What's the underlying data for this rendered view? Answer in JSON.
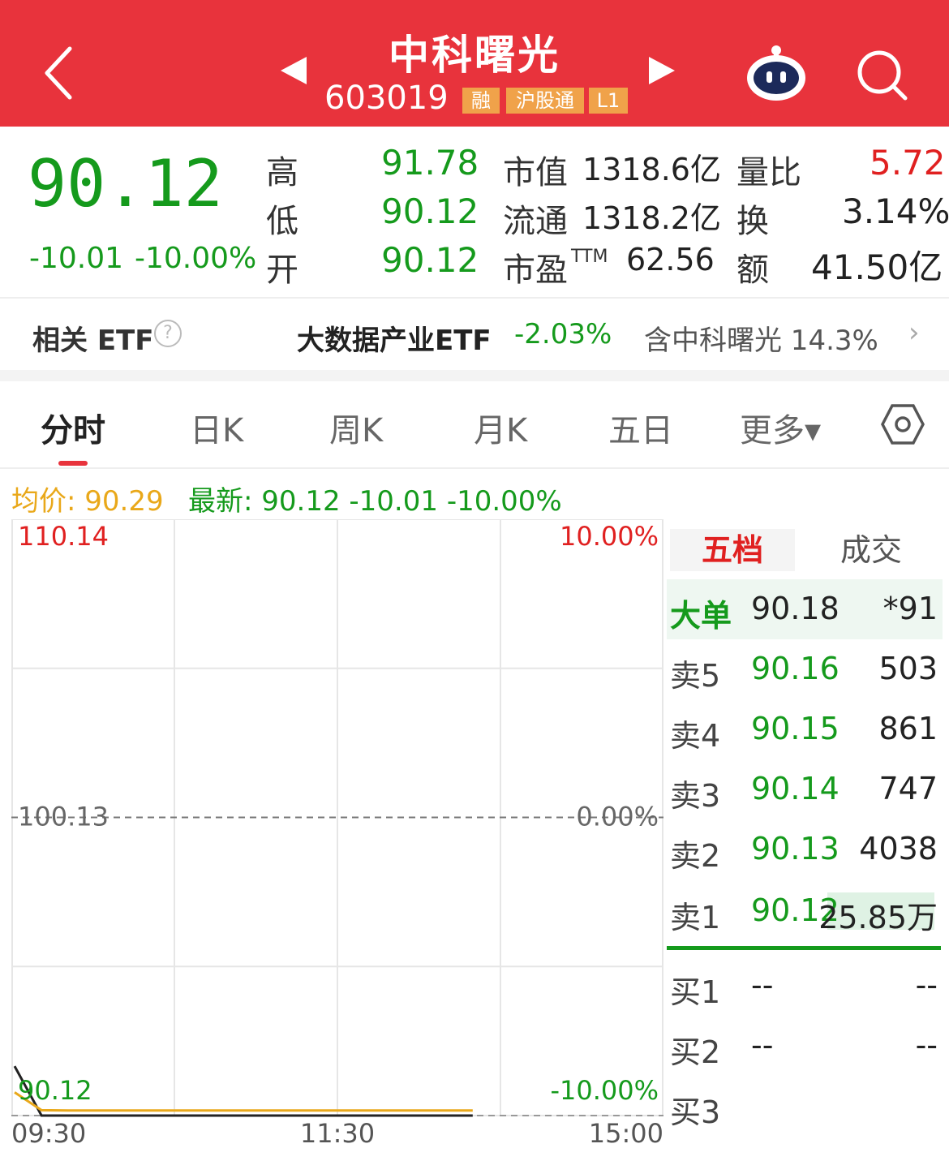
{
  "header": {
    "stock_name": "中科曙光",
    "stock_code": "603019",
    "tags": [
      "融",
      "沪股通",
      "L1"
    ]
  },
  "quote": {
    "price": "90.12",
    "change": "-10.01",
    "change_pct": "-10.00%",
    "high_label": "高",
    "high": "91.78",
    "low_label": "低",
    "low": "90.12",
    "open_label": "开",
    "open": "90.12",
    "mktcap_label": "市值",
    "mktcap": "1318.6亿",
    "float_label": "流通",
    "float": "1318.2亿",
    "pe_label": "市盈",
    "pe_sup": "TTM",
    "pe": "62.56",
    "volratio_label": "量比",
    "volratio": "5.72",
    "turnover_label": "换",
    "turnover": "3.14%",
    "amount_label": "额",
    "amount": "41.50亿"
  },
  "etf": {
    "title": "相关 ETF",
    "help": "?",
    "name": "大数据产业ETF",
    "change": "-2.03%",
    "holding": "含中科曙光 14.3%",
    "arrow": "›"
  },
  "tabs": [
    "分时",
    "日K",
    "周K",
    "月K",
    "五日",
    "更多▾"
  ],
  "info_line": {
    "avg": "均价: 90.29",
    "latest": "最新: 90.12  -10.01  -10.00%"
  },
  "chart_data": {
    "type": "line",
    "title": "",
    "y_left_ticks": [
      "110.14",
      "100.13",
      "90.12"
    ],
    "y_right_ticks": [
      "10.00%",
      "0.00%",
      "-10.00%"
    ],
    "x_ticks": [
      "09:30",
      "11:30",
      "15:00"
    ],
    "ylim": [
      90.12,
      110.14
    ],
    "prev_close": 100.13,
    "series": [
      {
        "name": "price",
        "color": "#222222",
        "values": [
          91.78,
          90.12,
          90.12,
          90.12,
          90.12,
          90.12,
          90.12,
          90.12,
          90.12,
          90.12,
          90.12,
          90.12,
          90.12,
          90.12,
          90.12,
          90.12,
          90.12,
          90.12
        ]
      },
      {
        "name": "avg",
        "color": "#e9a81a",
        "values": [
          90.9,
          90.3,
          90.29,
          90.29,
          90.29,
          90.29,
          90.29,
          90.29,
          90.29,
          90.29,
          90.29,
          90.29,
          90.29,
          90.29,
          90.29,
          90.29,
          90.29,
          90.29
        ]
      }
    ]
  },
  "orderbook": {
    "tab_active": "五档",
    "tab_other": "成交",
    "big_order": {
      "label": "大单",
      "price": "90.18",
      "vol": "*91"
    },
    "sells": [
      {
        "label": "卖5",
        "price": "90.16",
        "vol": "503"
      },
      {
        "label": "卖4",
        "price": "90.15",
        "vol": "861"
      },
      {
        "label": "卖3",
        "price": "90.14",
        "vol": "747"
      },
      {
        "label": "卖2",
        "price": "90.13",
        "vol": "4038"
      },
      {
        "label": "卖1",
        "price": "90.12",
        "vol": "25.85万"
      }
    ],
    "buys": [
      {
        "label": "买1",
        "price": "--",
        "vol": "--"
      },
      {
        "label": "买2",
        "price": "--",
        "vol": "--"
      },
      {
        "label": "买3",
        "price": "",
        "vol": ""
      }
    ]
  }
}
